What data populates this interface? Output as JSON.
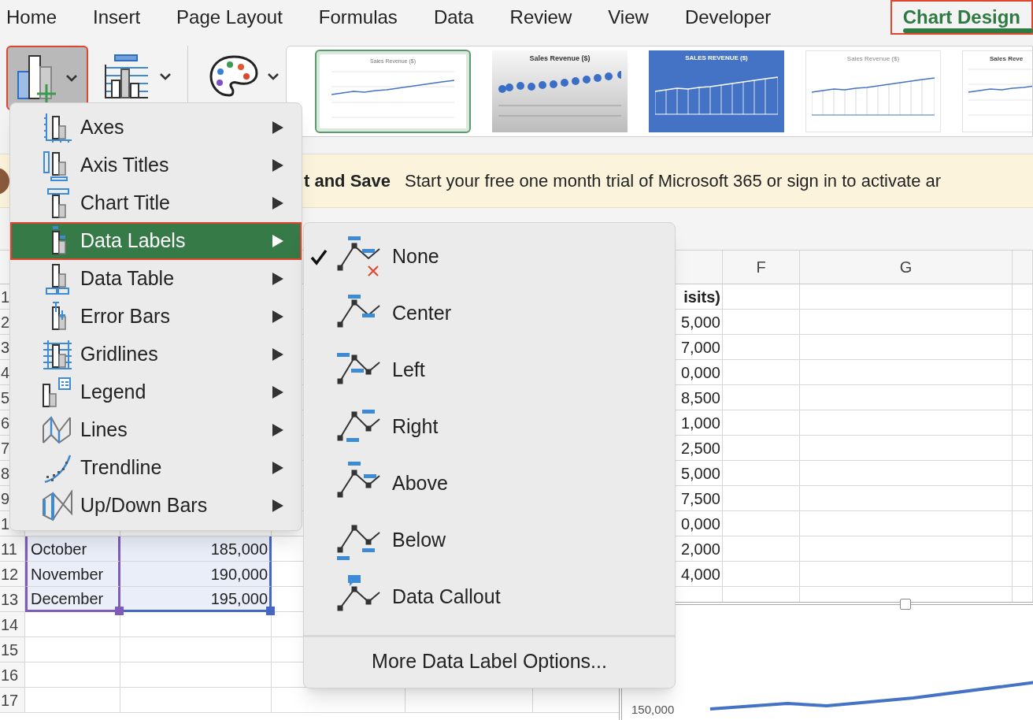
{
  "ribbon_tabs": [
    {
      "label": "Home",
      "selected": false,
      "highlighted": false
    },
    {
      "label": "Insert",
      "selected": false,
      "highlighted": false
    },
    {
      "label": "Page Layout",
      "selected": false,
      "highlighted": false
    },
    {
      "label": "Formulas",
      "selected": false,
      "highlighted": false
    },
    {
      "label": "Data",
      "selected": false,
      "highlighted": false
    },
    {
      "label": "Review",
      "selected": false,
      "highlighted": false
    },
    {
      "label": "View",
      "selected": false,
      "highlighted": false
    },
    {
      "label": "Developer",
      "selected": false,
      "highlighted": false
    },
    {
      "label": "Chart Design",
      "selected": true,
      "highlighted": true
    }
  ],
  "toolbar": {
    "add_chart_element": {
      "pressed": true,
      "highlighted": true
    }
  },
  "chart_styles": [
    {
      "title": "Sales Revenue ($)",
      "kind": "plain",
      "selected": true
    },
    {
      "title": "Sales Revenue ($)",
      "kind": "dots",
      "selected": false
    },
    {
      "title": "SALES REVENUE ($)",
      "kind": "blue",
      "selected": false
    },
    {
      "title": "Sales Revenue ($)",
      "kind": "drop",
      "selected": false
    },
    {
      "title": "Sales Reve",
      "kind": "bold",
      "selected": false
    }
  ],
  "notification": {
    "title": "t and Save",
    "message": "Start your free one month trial of Microsoft 365 or sign in to activate ar"
  },
  "sheet": {
    "column_headers": [
      {
        "label": "F"
      },
      {
        "label": "G"
      }
    ],
    "rows": [
      {
        "number": "1",
        "visits": "isits)",
        "header": true
      },
      {
        "number": "2",
        "visits": "5,000",
        "header": false
      },
      {
        "number": "3",
        "visits": "7,000",
        "header": false
      },
      {
        "number": "4",
        "visits": "0,000",
        "header": false
      },
      {
        "number": "5",
        "visits": "8,500",
        "header": false
      },
      {
        "number": "6",
        "visits": "1,000",
        "header": false
      },
      {
        "number": "7",
        "visits": "2,500",
        "header": false
      },
      {
        "number": "8",
        "visits": "5,000",
        "header": false
      },
      {
        "number": "9",
        "visits": "7,500",
        "header": false
      },
      {
        "number": "1",
        "visits": "0,000",
        "header": false
      },
      {
        "number": "11",
        "month": "October",
        "revenue": "185,000",
        "visits": "2,000",
        "header": false,
        "highlighted": true
      },
      {
        "number": "12",
        "month": "November",
        "revenue": "190,000",
        "visits": "4,000",
        "header": false,
        "highlighted": true
      },
      {
        "number": "13",
        "month": "December",
        "revenue": "195,000",
        "highlighted": true
      },
      {
        "number": "14",
        "highlighted": false
      },
      {
        "number": "15",
        "highlighted": false
      },
      {
        "number": "16",
        "highlighted": false
      },
      {
        "number": "17",
        "highlighted": false
      }
    ]
  },
  "chart": {
    "y_tick": "150,000"
  },
  "chart_element_menu": {
    "items": [
      {
        "label": "Axes",
        "kind": "axes",
        "selected": false,
        "highlighted": false
      },
      {
        "label": "Axis Titles",
        "kind": "axistitles",
        "selected": false,
        "highlighted": false
      },
      {
        "label": "Chart Title",
        "kind": "charttitle",
        "selected": false,
        "highlighted": false
      },
      {
        "label": "Data Labels",
        "kind": "datalabels",
        "selected": true,
        "highlighted": true
      },
      {
        "label": "Data Table",
        "kind": "datatable",
        "selected": false,
        "highlighted": false
      },
      {
        "label": "Error Bars",
        "kind": "errorbars",
        "selected": false,
        "highlighted": false
      },
      {
        "label": "Gridlines",
        "kind": "gridlines",
        "selected": false,
        "highlighted": false
      },
      {
        "label": "Legend",
        "kind": "legend",
        "selected": false,
        "highlighted": false
      },
      {
        "label": "Lines",
        "kind": "lines",
        "selected": false,
        "highlighted": false
      },
      {
        "label": "Trendline",
        "kind": "trendline",
        "selected": false,
        "highlighted": false
      },
      {
        "label": "Up/Down Bars",
        "kind": "updown",
        "selected": false,
        "highlighted": false
      }
    ]
  },
  "data_labels_menu": {
    "items": [
      {
        "label": "None",
        "kind": "none",
        "checked": true
      },
      {
        "label": "Center",
        "kind": "center",
        "checked": false
      },
      {
        "label": "Left",
        "kind": "left",
        "checked": false
      },
      {
        "label": "Right",
        "kind": "right",
        "checked": false
      },
      {
        "label": "Above",
        "kind": "above",
        "checked": false
      },
      {
        "label": "Below",
        "kind": "below",
        "checked": false
      },
      {
        "label": "Data Callout",
        "kind": "callout",
        "checked": false
      }
    ],
    "more": "More Data Label Options..."
  }
}
